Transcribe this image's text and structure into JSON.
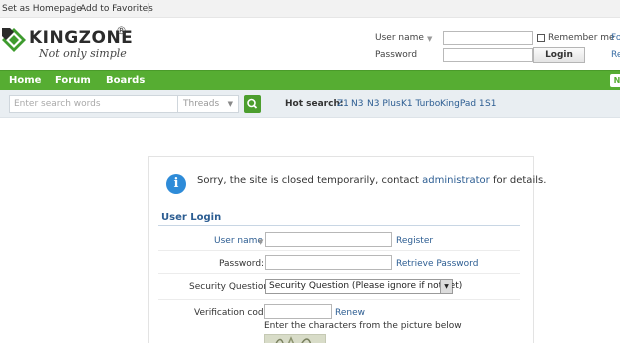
{
  "topbar": {
    "set_homepage": "Set as Homepage",
    "add_favorites": "Add to Favorites"
  },
  "header": {
    "brand": "KINGZONE",
    "registered_mark": "®",
    "tagline": "Not only simple",
    "login": {
      "username_label": "User name",
      "password_label": "Password",
      "remember_label": "Remember me",
      "login_button": "Login",
      "edge_text_1": "Fo",
      "edge_text_2": "Re"
    }
  },
  "nav": {
    "items": [
      {
        "label": "Home"
      },
      {
        "label": "Forum"
      },
      {
        "label": "Boards"
      }
    ],
    "right_badge": "N"
  },
  "search": {
    "placeholder": "Enter search words",
    "scope": "Threads",
    "hot_label": "Hot search:",
    "hot_terms": [
      "Z1",
      "N3",
      "N3 Plus",
      "K1 Turbo",
      "KingPad 1",
      "S1"
    ]
  },
  "notice": {
    "text_before": "Sorry, the site is closed temporarily, contact ",
    "link": "administrator",
    "text_after": " for details."
  },
  "user_login": {
    "title": "User Login",
    "username_label": "User name",
    "register_link": "Register",
    "password_label": "Password:",
    "retrieve_link": "Retrieve Password",
    "security_label": "Security Question:",
    "security_value": "Security Question (Please ignore if not set)",
    "verification_label": "Verification code:",
    "renew_link": "Renew",
    "hint": "Enter the characters from the picture below"
  },
  "colors": {
    "nav_green": "#56ad32",
    "link_blue": "#2c5d92",
    "info_blue": "#2e8bd8"
  }
}
